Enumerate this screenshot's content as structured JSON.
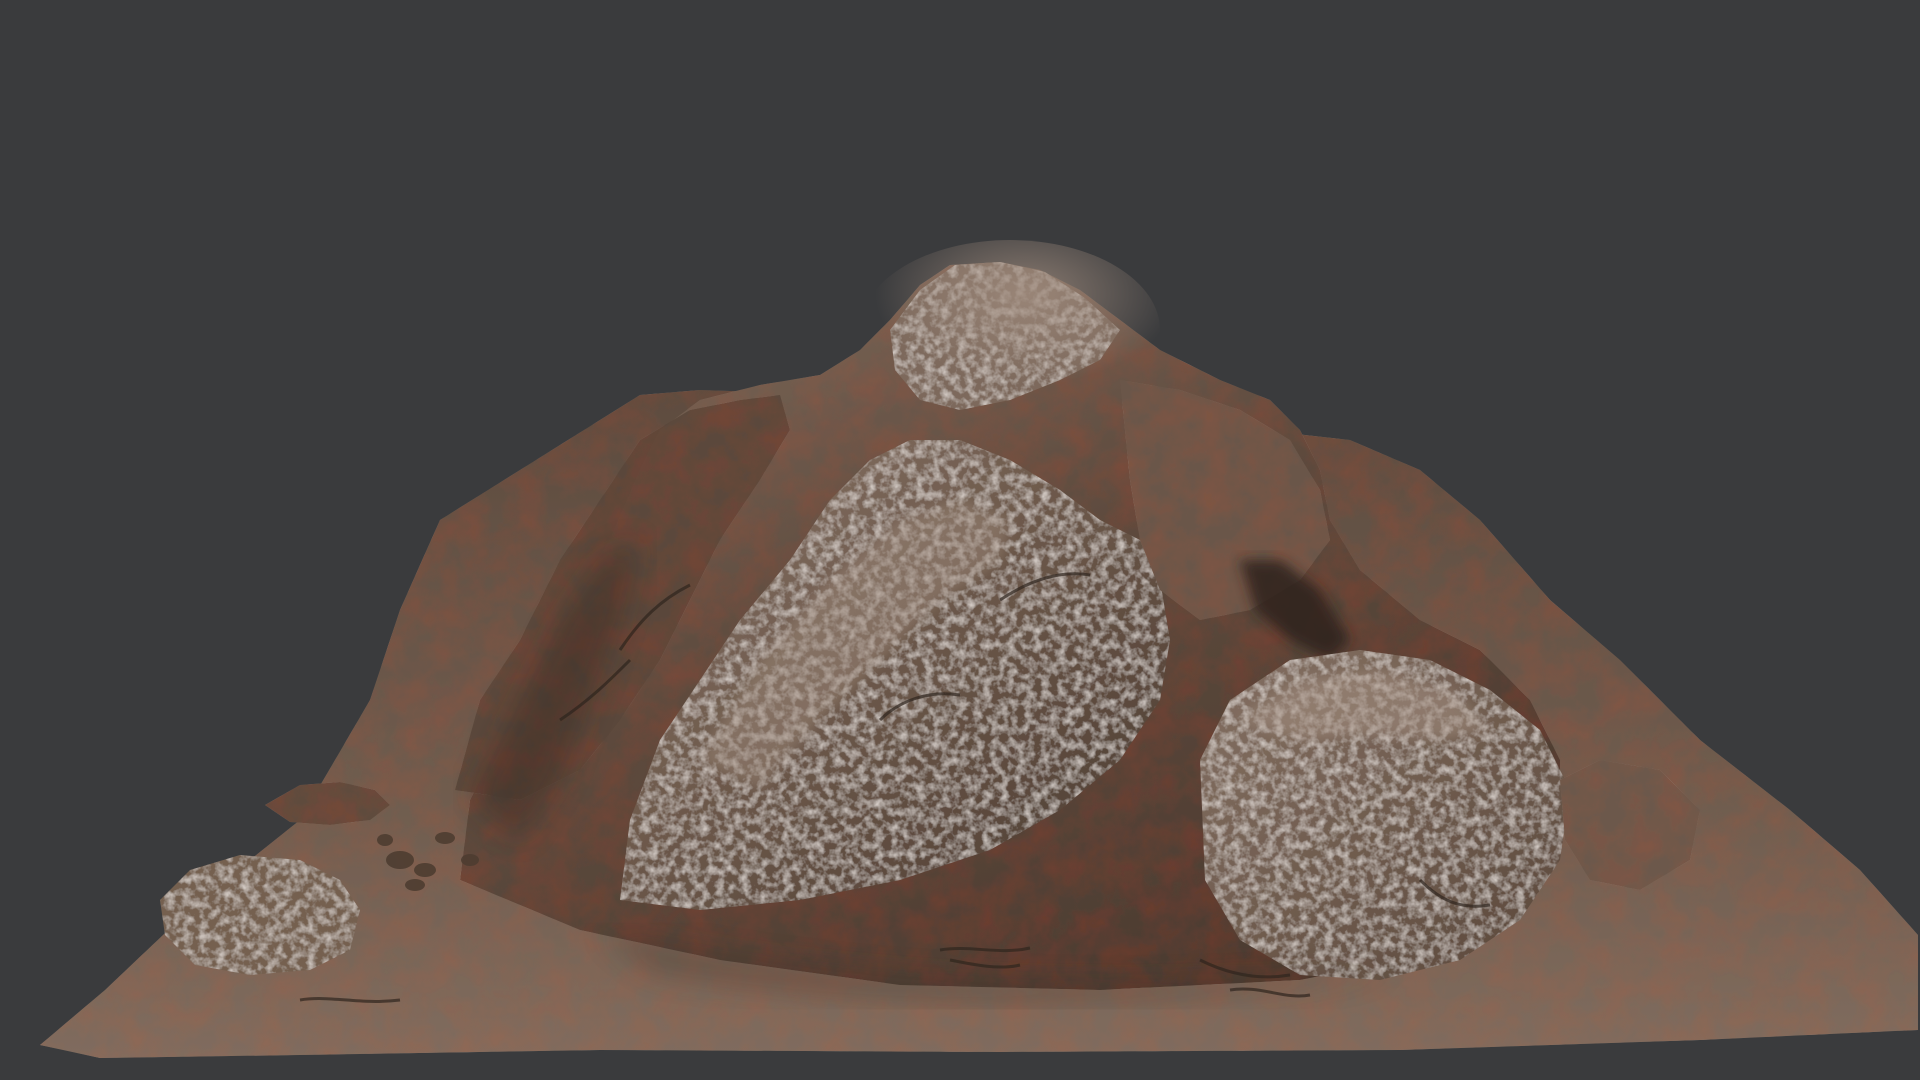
{
  "scene": {
    "background_color": "#3a3b3d",
    "subject": "rock-terrain-model",
    "colors": {
      "ground": "#6e5a4b",
      "ground_light": "#8c7868",
      "rock_dark": "#3e3128",
      "rock_mid": "#5f4c3f",
      "rock_light": "#9a877a",
      "highlight": "#b8a89c"
    }
  }
}
